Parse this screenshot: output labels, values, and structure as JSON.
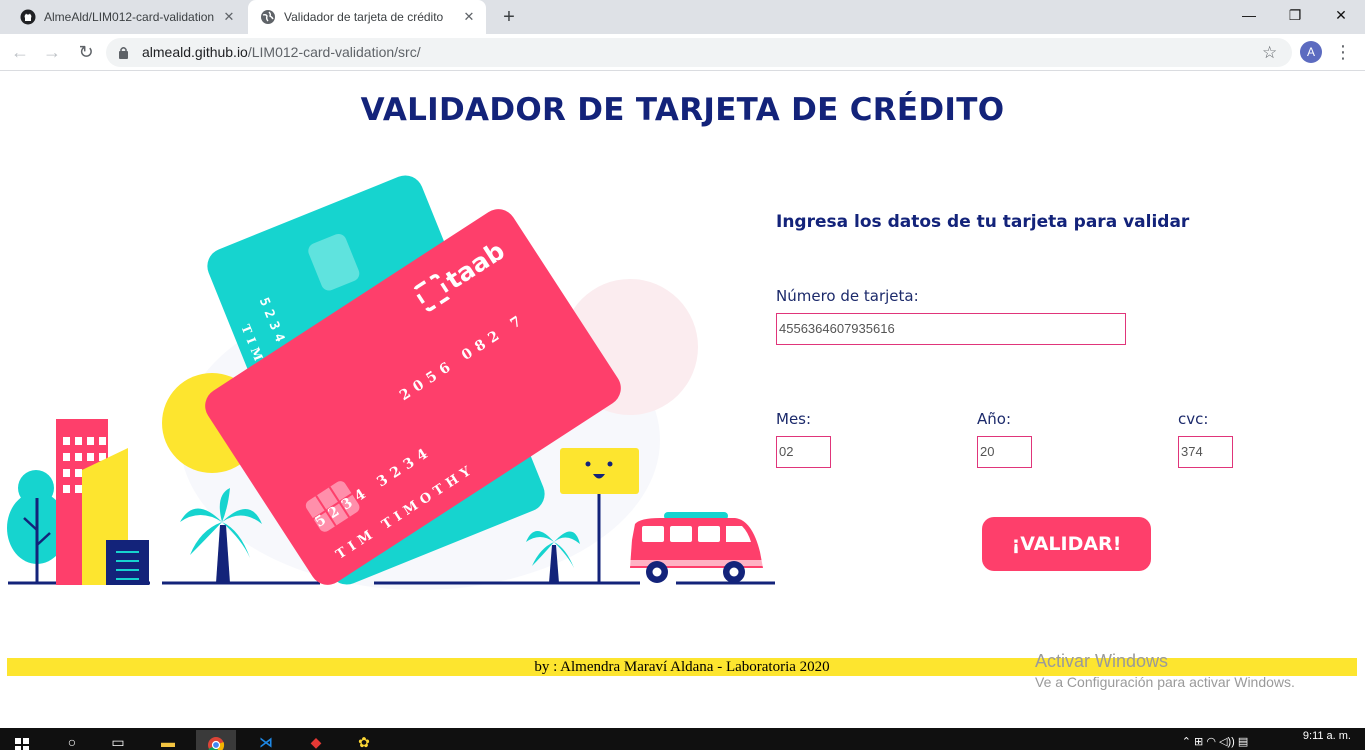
{
  "browser": {
    "tabs": [
      {
        "title": "AlmeAld/LIM012-card-validation",
        "icon": "github-icon",
        "active": false
      },
      {
        "title": "Validador de tarjeta de crédito",
        "icon": "globe-icon",
        "active": true
      }
    ],
    "url_host": "almeald.github.io",
    "url_path": "/LIM012-card-validation/src/",
    "profile_initial": "A"
  },
  "page": {
    "title": "VALIDADOR DE TARJETA DE CRÉDITO",
    "form_heading": "Ingresa los datos de tu tarjeta para validar",
    "card_number_label": "Número de tarjeta:",
    "card_number_value": "4556364607935616",
    "month_label": "Mes:",
    "month_value": "02",
    "year_label": "Año:",
    "year_value": "20",
    "cvc_label": "cvc:",
    "cvc_value": "374",
    "validate_button": "¡VALIDAR!",
    "footer": "by : Almendra Maraví Aldana - Laboratoria 2020"
  },
  "illustration": {
    "back_card_number": "5234",
    "back_card_name": "TIM TIM",
    "front_card_brand": "taab",
    "front_card_number_top": "2056 082 7",
    "front_card_number": "5234 3234",
    "front_card_name": "TIM TIMOTHY",
    "colors": {
      "pink": "#fe3f6b",
      "teal": "#16d4cf",
      "yellow": "#fde52f",
      "navy": "#13237a"
    }
  },
  "watermark": {
    "line1": "Activar Windows",
    "line2": "Ve a Configuración para activar Windows."
  },
  "taskbar": {
    "clock": "9:11 a. m."
  }
}
